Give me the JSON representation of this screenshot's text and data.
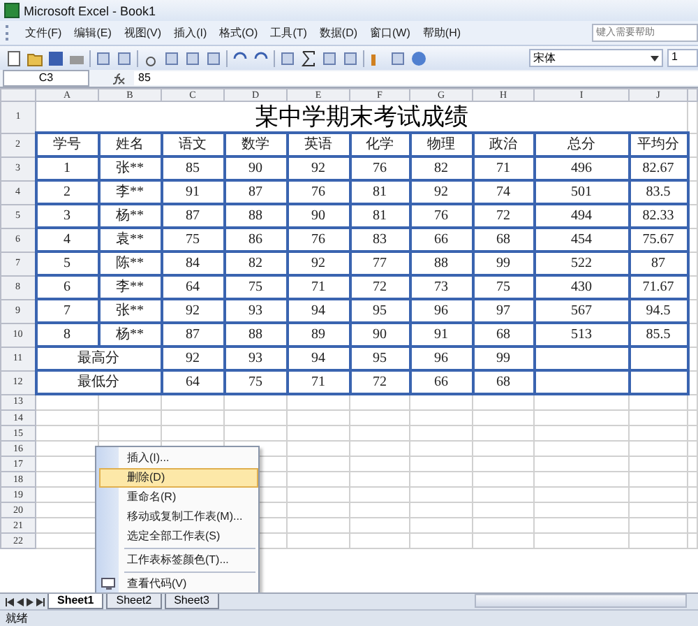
{
  "window": {
    "title": "Microsoft Excel - Book1"
  },
  "menu_bar": {
    "items": [
      "文件(F)",
      "编辑(E)",
      "视图(V)",
      "插入(I)",
      "格式(O)",
      "工具(T)",
      "数据(D)",
      "窗口(W)",
      "帮助(H)"
    ],
    "help_search": {
      "placeholder": "键入需要帮助"
    }
  },
  "toolbar": {
    "font": "宋体",
    "font_size": "1"
  },
  "formula_bar": {
    "name_box": "C3",
    "value": "85"
  },
  "sheet": {
    "column_headers": [
      "A",
      "B",
      "C",
      "D",
      "E",
      "F",
      "G",
      "H",
      "I",
      "J"
    ],
    "row_headers": [
      "1",
      "2",
      "3",
      "4",
      "5",
      "6",
      "7",
      "8",
      "9",
      "10",
      "11",
      "12",
      "13",
      "14",
      "15",
      "16",
      "17",
      "18",
      "19",
      "20",
      "21",
      "22"
    ],
    "title": "某中学期末考试成绩",
    "header": [
      "学号",
      "姓名",
      "语文",
      "数学",
      "英语",
      "化学",
      "物理",
      "政治",
      "总分",
      "平均分"
    ],
    "rows": [
      [
        "1",
        "张**",
        "85",
        "90",
        "92",
        "76",
        "82",
        "71",
        "496",
        "82.67"
      ],
      [
        "2",
        "李**",
        "91",
        "87",
        "76",
        "81",
        "92",
        "74",
        "501",
        "83.5"
      ],
      [
        "3",
        "杨**",
        "87",
        "88",
        "90",
        "81",
        "76",
        "72",
        "494",
        "82.33"
      ],
      [
        "4",
        "袁**",
        "75",
        "86",
        "76",
        "83",
        "66",
        "68",
        "454",
        "75.67"
      ],
      [
        "5",
        "陈**",
        "84",
        "82",
        "92",
        "77",
        "88",
        "99",
        "522",
        "87"
      ],
      [
        "6",
        "李**",
        "64",
        "75",
        "71",
        "72",
        "73",
        "75",
        "430",
        "71.67"
      ],
      [
        "7",
        "张**",
        "92",
        "93",
        "94",
        "95",
        "96",
        "97",
        "567",
        "94.5"
      ],
      [
        "8",
        "杨**",
        "87",
        "88",
        "89",
        "90",
        "91",
        "68",
        "513",
        "85.5"
      ]
    ],
    "summary": [
      {
        "label": "最高分",
        "values": [
          "92",
          "93",
          "94",
          "95",
          "96",
          "99"
        ]
      },
      {
        "label": "最低分",
        "values": [
          "64",
          "75",
          "71",
          "72",
          "66",
          "68"
        ]
      }
    ]
  },
  "context_menu": {
    "items": [
      {
        "label": "插入(I)...",
        "selected": false,
        "divider_above": false
      },
      {
        "label": "删除(D)",
        "selected": true,
        "divider_above": false
      },
      {
        "label": "重命名(R)",
        "selected": false,
        "divider_above": false
      },
      {
        "label": "移动或复制工作表(M)...",
        "selected": false,
        "divider_above": false
      },
      {
        "label": "选定全部工作表(S)",
        "selected": false,
        "divider_above": false
      },
      {
        "label": "工作表标签颜色(T)...",
        "selected": false,
        "divider_above": true
      },
      {
        "label": "查看代码(V)",
        "selected": false,
        "divider_above": true,
        "kind": "code"
      }
    ]
  },
  "sheet_tabs": [
    {
      "label": "Sheet1",
      "selected": true
    },
    {
      "label": "Sheet2",
      "selected": false
    },
    {
      "label": "Sheet3",
      "selected": false
    }
  ],
  "status_bar": {
    "text": "就绪"
  }
}
